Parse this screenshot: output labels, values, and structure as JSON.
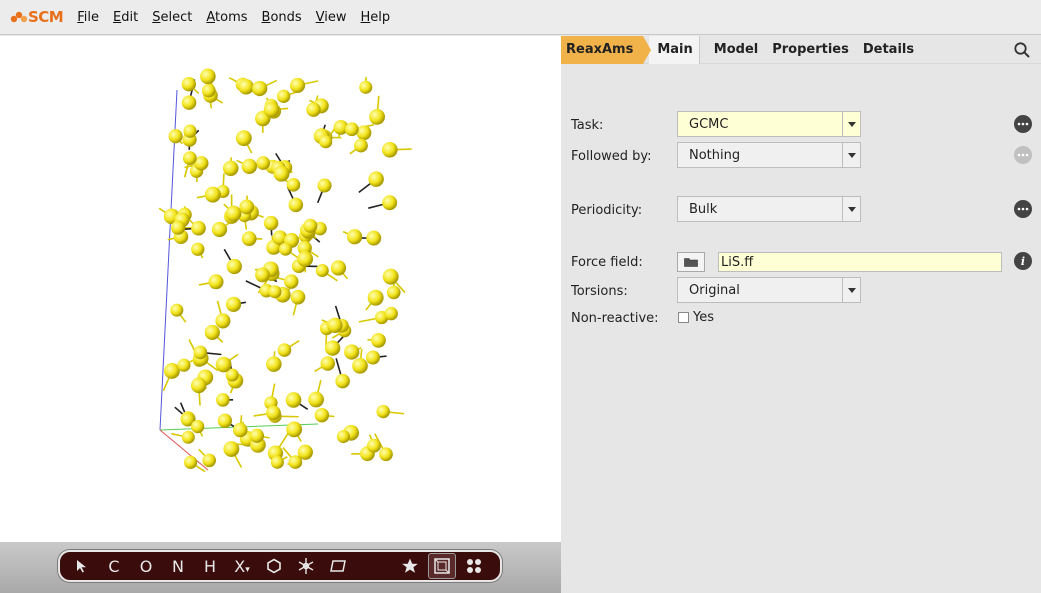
{
  "app": {
    "logo_text": "SCM",
    "accent_color": "#e8701a"
  },
  "menu": {
    "items": [
      {
        "underline": "F",
        "rest": "ile"
      },
      {
        "underline": "E",
        "rest": "dit"
      },
      {
        "underline": "S",
        "rest": "elect"
      },
      {
        "underline": "A",
        "rest": "toms"
      },
      {
        "underline": "B",
        "rest": "onds"
      },
      {
        "underline": "V",
        "rest": "iew"
      },
      {
        "underline": "H",
        "rest": "elp"
      }
    ]
  },
  "toolbar": {
    "tools": [
      {
        "icon": "pointer-icon",
        "label": ""
      },
      {
        "icon": "",
        "label": "C"
      },
      {
        "icon": "",
        "label": "O"
      },
      {
        "icon": "",
        "label": "N"
      },
      {
        "icon": "",
        "label": "H"
      },
      {
        "icon": "",
        "label": "X"
      },
      {
        "icon": "hexagon-icon",
        "label": ""
      },
      {
        "icon": "snowflake-icon",
        "label": ""
      },
      {
        "icon": "plane-icon",
        "label": ""
      }
    ],
    "right_tools": [
      {
        "icon": "star-icon"
      },
      {
        "icon": "unit-cell-icon"
      },
      {
        "icon": "molecules-icon"
      }
    ]
  },
  "panel": {
    "breadcrumb": "ReaxAms",
    "tabs": [
      "Main",
      "Model",
      "Properties",
      "Details"
    ],
    "active_tab": "Main",
    "task": {
      "label": "Task:",
      "value": "GCMC"
    },
    "followed_by": {
      "label": "Followed by:",
      "value": "Nothing"
    },
    "periodicity": {
      "label": "Periodicity:",
      "value": "Bulk"
    },
    "force_field": {
      "label": "Force field:",
      "value": "LiS.ff"
    },
    "torsions": {
      "label": "Torsions:",
      "value": "Original"
    },
    "non_reactive": {
      "label": "Non-reactive:",
      "checkbox_label": "Yes",
      "checked": false
    }
  }
}
